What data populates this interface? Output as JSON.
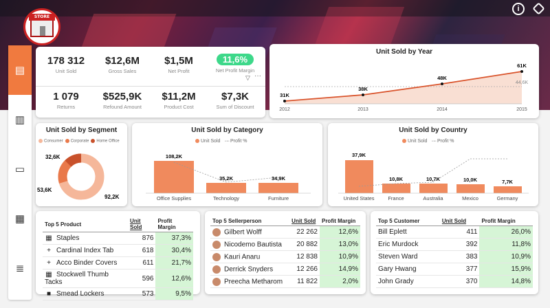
{
  "logo": {
    "label": "STORE"
  },
  "topicons": {
    "info": "i"
  },
  "kpis": [
    {
      "value": "178 312",
      "label": "Unit Sold"
    },
    {
      "value": "$12,6M",
      "label": "Gross Sales"
    },
    {
      "value": "$1,5M",
      "label": "Net Profit"
    },
    {
      "value": "11,6%",
      "label": "Net Profit Margin"
    },
    {
      "value": "1 079",
      "label": "Returns"
    },
    {
      "value": "$525,9K",
      "label": "Refound Amount"
    },
    {
      "value": "$11,2M",
      "label": "Product Cost"
    },
    {
      "value": "$7,3K",
      "label": "Sum of Discount"
    }
  ],
  "year_chart": {
    "title": "Unit Sold by Year",
    "labels": [
      "31K",
      "38K",
      "48K",
      "61K"
    ],
    "extra_label": "44,6K",
    "ticks": [
      "2012",
      "2013",
      "2014",
      "2015"
    ]
  },
  "segment_chart": {
    "title": "Unit Sold by Segment",
    "legend": [
      "Consumer",
      "Corporate",
      "Home Office"
    ],
    "labels": [
      "32,6K",
      "53,6K",
      "92,2K"
    ]
  },
  "category_chart": {
    "title": "Unit Sold by Category",
    "legend": [
      "Unit Sold",
      "Profit %"
    ],
    "labels": [
      "108,2K",
      "35,2K",
      "34,9K"
    ],
    "ticks": [
      "Office Supplies",
      "Technology",
      "Furniture"
    ]
  },
  "country_chart": {
    "title": "Unit Sold by Country",
    "legend": [
      "Unit Sold",
      "Profit %"
    ],
    "labels": [
      "37,9K",
      "10,8K",
      "10,7K",
      "10,0K",
      "7,7K"
    ],
    "ticks": [
      "United States",
      "France",
      "Australia",
      "Mexico",
      "Germany"
    ]
  },
  "chart_data": [
    {
      "type": "line",
      "title": "Unit Sold by Year",
      "x": [
        2012,
        2013,
        2014,
        2015
      ],
      "values": [
        31,
        38,
        48,
        61
      ],
      "reference": 44.6,
      "ylabel": ""
    },
    {
      "type": "pie",
      "title": "Unit Sold by Segment",
      "categories": [
        "Consumer",
        "Corporate",
        "Home Office"
      ],
      "values": [
        92.2,
        53.6,
        32.6
      ]
    },
    {
      "type": "bar",
      "title": "Unit Sold by Category",
      "categories": [
        "Office Supplies",
        "Technology",
        "Furniture"
      ],
      "series": [
        {
          "name": "Unit Sold",
          "values": [
            108.2,
            35.2,
            34.9
          ]
        }
      ]
    },
    {
      "type": "bar",
      "title": "Unit Sold by Country",
      "categories": [
        "United States",
        "France",
        "Australia",
        "Mexico",
        "Germany"
      ],
      "series": [
        {
          "name": "Unit Sold",
          "values": [
            37.9,
            10.8,
            10.7,
            10.0,
            7.7
          ]
        }
      ]
    }
  ],
  "products": {
    "headers": [
      "Top 5 Product",
      "Unit Sold",
      "Profit Margin"
    ],
    "rows": [
      {
        "icon": "▦",
        "name": "Staples",
        "units": "876",
        "margin": "37,3%"
      },
      {
        "icon": "+",
        "name": "Cardinal Index Tab",
        "units": "618",
        "margin": "30,4%"
      },
      {
        "icon": "+",
        "name": "Acco Binder Covers",
        "units": "611",
        "margin": "21,7%"
      },
      {
        "icon": "▦",
        "name": "Stockwell Thumb Tacks",
        "units": "596",
        "margin": "12,6%"
      },
      {
        "icon": "■",
        "name": "Smead Lockers",
        "units": "573",
        "margin": "9,5%"
      }
    ]
  },
  "sellers": {
    "headers": [
      "Top 5 Sellerperson",
      "Unit Sold",
      "Profit Margin"
    ],
    "rows": [
      {
        "name": "Gilbert Wolff",
        "units": "22 262",
        "margin": "12,6%"
      },
      {
        "name": "Nicodemo Bautista",
        "units": "20 882",
        "margin": "13,0%"
      },
      {
        "name": "Kauri Anaru",
        "units": "12 838",
        "margin": "10,9%"
      },
      {
        "name": "Derrick Snyders",
        "units": "12 266",
        "margin": "14,9%"
      },
      {
        "name": "Preecha Metharom",
        "units": "11 822",
        "margin": "2,0%"
      }
    ]
  },
  "customers": {
    "headers": [
      "Top 5 Customer",
      "Unit Sold",
      "Profit Margin"
    ],
    "rows": [
      {
        "name": "Bill Eplett",
        "units": "411",
        "margin": "26,0%"
      },
      {
        "name": "Eric Murdock",
        "units": "392",
        "margin": "11,8%"
      },
      {
        "name": "Steven Ward",
        "units": "383",
        "margin": "10,9%"
      },
      {
        "name": "Gary Hwang",
        "units": "377",
        "margin": "15,9%"
      },
      {
        "name": "John Grady",
        "units": "370",
        "margin": "14,8%"
      }
    ]
  },
  "colors": {
    "accent": "#f07a3f",
    "bar": "#f08a5d",
    "green": "#3dd88a"
  }
}
